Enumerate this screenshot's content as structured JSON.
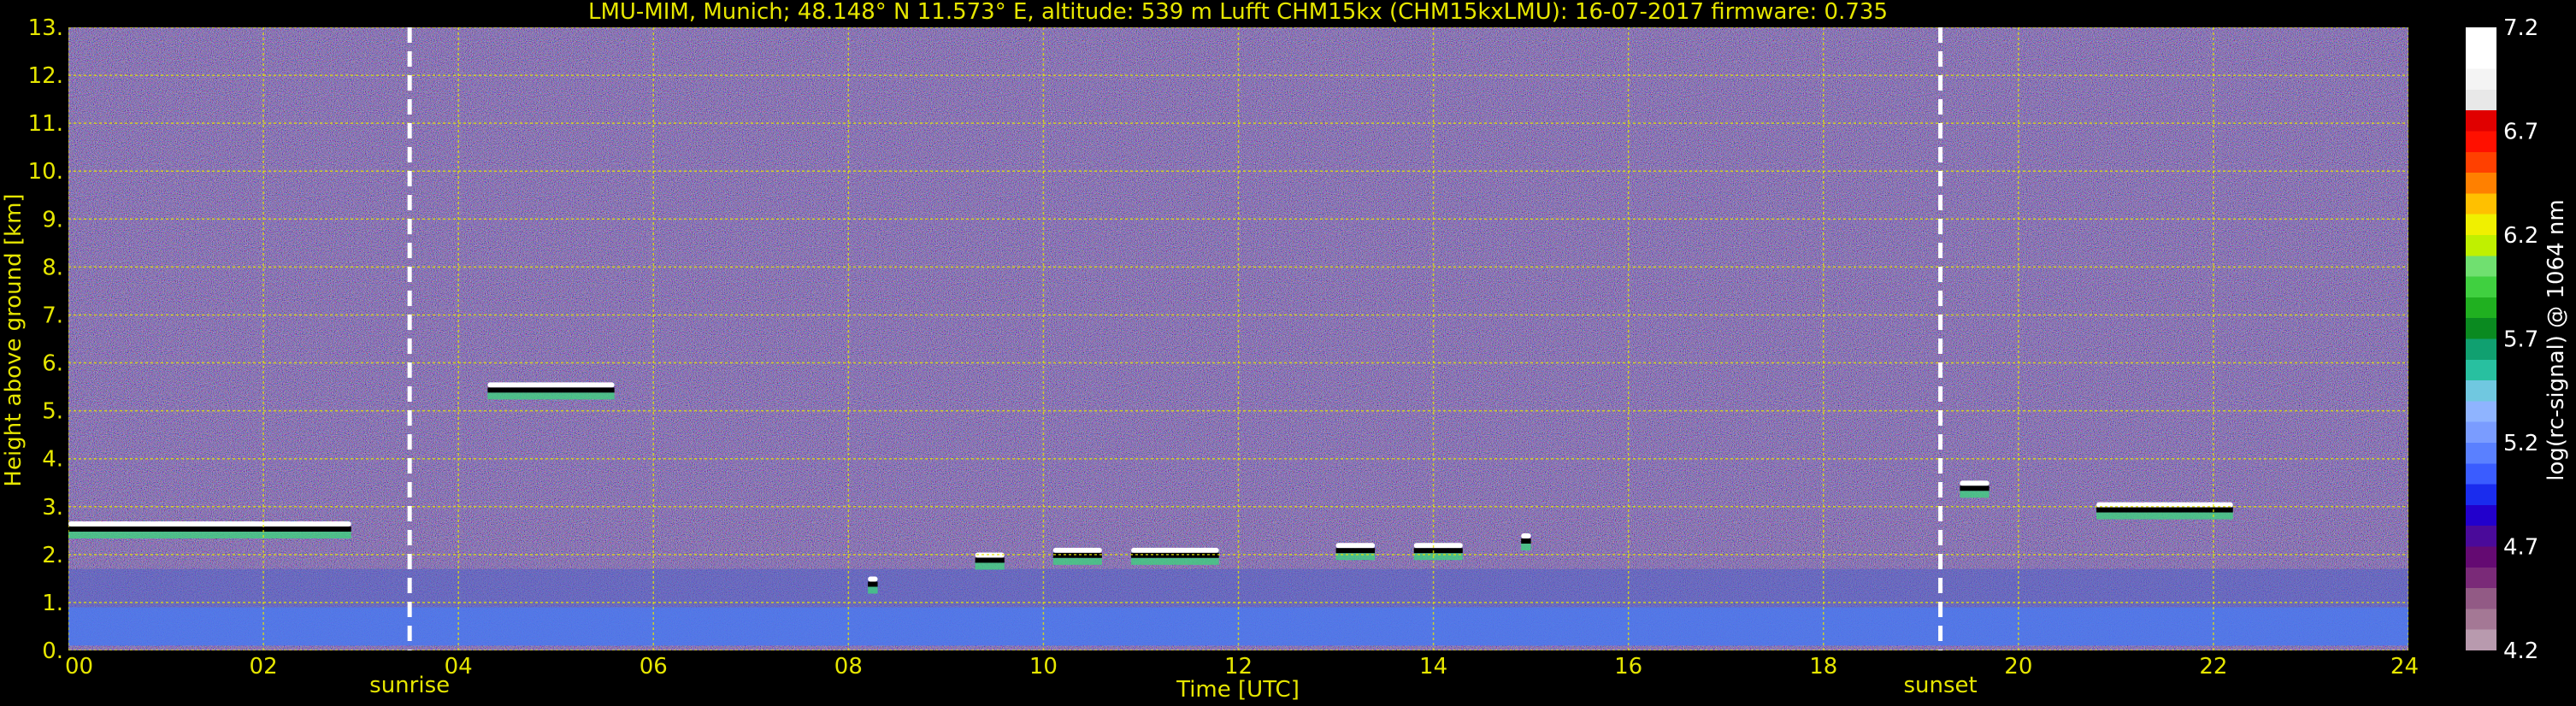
{
  "chart_data": {
    "type": "heatmap",
    "title": "LMU-MIM, Munich; 48.148° N 11.573° E, altitude: 539 m    Lufft CHM15kx (CHM15kxLMU): 16-07-2017    firmware: 0.735",
    "xlabel": "Time [UTC]",
    "ylabel": "Height above ground [km]",
    "xlim": [
      0,
      24
    ],
    "ylim": [
      0,
      13
    ],
    "x_ticks": [
      "00",
      "02",
      "04",
      "06",
      "08",
      "10",
      "12",
      "14",
      "16",
      "18",
      "20",
      "22",
      "24"
    ],
    "y_ticks": [
      "0.",
      "1.",
      "2.",
      "3.",
      "4.",
      "5.",
      "6.",
      "7.",
      "8.",
      "9.",
      "10.",
      "11.",
      "12.",
      "13."
    ],
    "grid": true,
    "markers": [
      {
        "label": "sunrise",
        "x": 3.5
      },
      {
        "label": "sunset",
        "x": 19.2
      }
    ],
    "colorbar": {
      "label": "log(rc-signal) @ 1064 nm",
      "min": 4.2,
      "max": 7.2,
      "ticks": [
        "4.2",
        "4.7",
        "5.2",
        "5.7",
        "6.2",
        "6.7",
        "7.2"
      ],
      "colors": [
        "#b89aae",
        "#a47895",
        "#925a85",
        "#7a2a78",
        "#640a72",
        "#4a0a9a",
        "#2200cc",
        "#1a2cee",
        "#3a5cff",
        "#5a80ff",
        "#7a9cff",
        "#8fb4ff",
        "#70c8e0",
        "#28c0a0",
        "#10a070",
        "#0a8a20",
        "#20b020",
        "#40d040",
        "#70e070",
        "#c0f000",
        "#f0f000",
        "#ffc000",
        "#ff8000",
        "#ff4000",
        "#ff1000",
        "#e00000",
        "#e8e8e8",
        "#f4f4f4",
        "#ffffff",
        "#ffffff"
      ]
    },
    "layers": [
      {
        "name": "boundary-layer",
        "x_start": 0,
        "x_end": 24,
        "height_start": 0.9,
        "height_end": 1.7
      },
      {
        "name": "ground-layer",
        "x_start": 0,
        "x_end": 24,
        "height_start": 0.1,
        "height_end": 0.9
      }
    ],
    "clouds": [
      {
        "x_start": 0.0,
        "x_end": 2.9,
        "height": 2.55
      },
      {
        "x_start": 4.3,
        "x_end": 5.6,
        "height": 5.45
      },
      {
        "x_start": 8.2,
        "x_end": 8.3,
        "height": 1.4
      },
      {
        "x_start": 9.3,
        "x_end": 9.6,
        "height": 1.9
      },
      {
        "x_start": 10.1,
        "x_end": 10.6,
        "height": 2.0
      },
      {
        "x_start": 10.9,
        "x_end": 11.8,
        "height": 2.0
      },
      {
        "x_start": 13.0,
        "x_end": 13.4,
        "height": 2.1
      },
      {
        "x_start": 13.8,
        "x_end": 14.3,
        "height": 2.1
      },
      {
        "x_start": 14.9,
        "x_end": 15.0,
        "height": 2.3
      },
      {
        "x_start": 19.4,
        "x_end": 19.7,
        "height": 3.4
      },
      {
        "x_start": 20.8,
        "x_end": 22.2,
        "height": 2.95
      }
    ]
  }
}
